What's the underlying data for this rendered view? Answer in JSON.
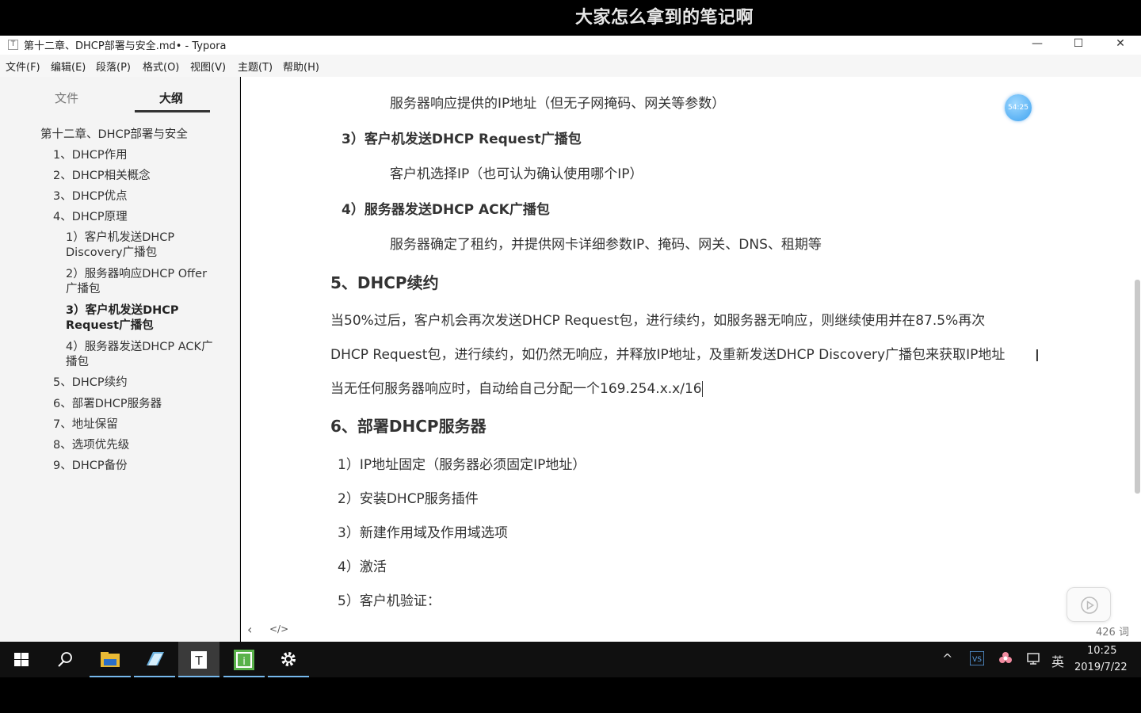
{
  "banner": {
    "text": "大家怎么拿到的笔记啊"
  },
  "window": {
    "icon_letter": "T",
    "title": "第十二章、DHCP部署与安全.md• - Typora",
    "minimize": "—",
    "maximize": "☐",
    "close": "✕"
  },
  "menu": [
    "文件(F)",
    "编辑(E)",
    "段落(P)",
    "格式(O)",
    "视图(V)",
    "主题(T)",
    "帮助(H)"
  ],
  "sidebar": {
    "tabs": [
      "文件",
      "大纲"
    ],
    "active_tab": "大纲",
    "outline": [
      "第十二章、DHCP部署与安全",
      "1、DHCP作用",
      "2、DHCP相关概念",
      "3、DHCP优点",
      "4、DHCP原理",
      "1）客户机发送DHCP Discovery广播包",
      "2）服务器响应DHCP Offer广播包",
      "3）客户机发送DHCP Request广播包",
      "4）服务器发送DHCP ACK广播包",
      "5、DHCP续约",
      "6、部署DHCP服务器",
      "7、地址保留",
      "8、选项优先级",
      "9、DHCP备份"
    ]
  },
  "editor": {
    "timer": "54:25",
    "lines": {
      "l1": "服务器响应提供的IP地址（但无子网掩码、网关等参数）",
      "h_req": "3）客户机发送DHCP Request广播包",
      "l2": "客户机选择IP（也可认为确认使用哪个IP）",
      "h_ack": "4）服务器发送DHCP ACK广播包",
      "l3": "服务器确定了租约，并提供网卡详细参数IP、掩码、网关、DNS、租期等",
      "h5": "5、DHCP续约",
      "p1": "当50%过后，客户机会再次发送DHCP Request包，进行续约，如服务器无响应，则继续使用并在87.5%再次",
      "p2": "DHCP Request包，进行续约，如仍然无响应，并释放IP地址，及重新发送DHCP Discovery广播包来获取IP地址",
      "p3": "当无任何服务器响应时，自动给自己分配一个169.254.x.x/16",
      "h6": "6、部署DHCP服务器",
      "s1": "1）IP地址固定（服务器必须固定IP地址）",
      "s2": "2）安装DHCP服务插件",
      "s3": "3）新建作用域及作用域选项",
      "s4": "4）激活",
      "s5": "5）客户机验证："
    },
    "wordcount": "426 词",
    "back_icon": "‹",
    "source_icon": "</>"
  },
  "taskbar": {
    "tray": {
      "chevron": "^",
      "ime": "英",
      "time": "10:25",
      "date": "2019/7/22"
    }
  }
}
